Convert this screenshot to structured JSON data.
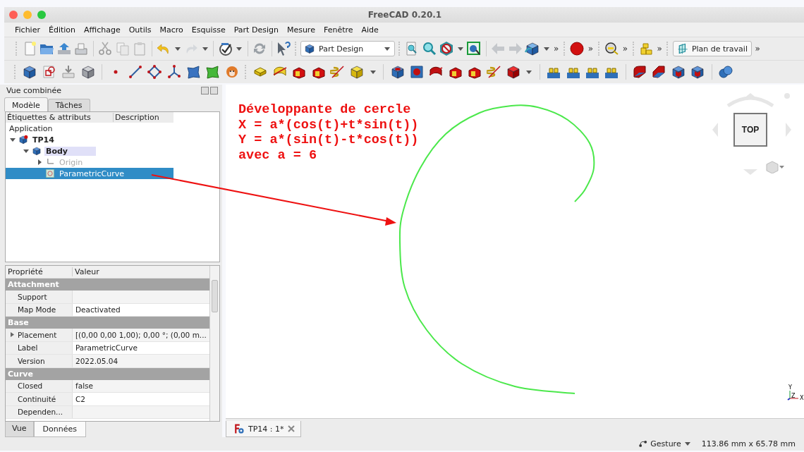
{
  "window": {
    "title": "FreeCAD 0.20.1"
  },
  "menu": [
    "Fichier",
    "Édition",
    "Affichage",
    "Outils",
    "Macro",
    "Esquisse",
    "Part Design",
    "Mesure",
    "Fenêtre",
    "Aide"
  ],
  "toolbar": {
    "workbench": "Part Design",
    "workplane_button": "Plan de travail",
    "chevrons": [
      "»",
      "»",
      "»",
      "»",
      "»"
    ]
  },
  "combo_view": {
    "title": "Vue combinée",
    "tabs": [
      {
        "label": "Modèle",
        "selected": true
      },
      {
        "label": "Tâches",
        "selected": false
      }
    ],
    "tree": {
      "columns": [
        "Étiquettes & attributs",
        "Description"
      ],
      "items": [
        {
          "label": "Application",
          "selected": false,
          "visible": true,
          "children": [
            {
              "label": "TP14",
              "kind": "document",
              "selected": false,
              "visible": true,
              "expanded": true,
              "children": [
                {
                  "label": "Body",
                  "kind": "body",
                  "selected": false,
                  "visible": true,
                  "active": true,
                  "expanded": true,
                  "children": [
                    {
                      "label": "Origin",
                      "kind": "origin",
                      "selected": false,
                      "visible": false,
                      "expanded": false
                    },
                    {
                      "label": "ParametricCurve",
                      "kind": "curve",
                      "selected": true,
                      "visible": true
                    }
                  ]
                }
              ]
            }
          ]
        }
      ]
    },
    "properties": {
      "columns": [
        "Propriété",
        "Valeur"
      ],
      "groups": [
        {
          "name": "Attachment",
          "rows": [
            {
              "name": "Support"
            },
            {
              "name": "Map Mode",
              "value": "Deactivated"
            }
          ]
        },
        {
          "name": "Base",
          "rows": [
            {
              "name": "Placement",
              "value": "[(0,00 0,00 1,00); 0,00 °; (0,00 m...",
              "expanded": false
            },
            {
              "name": "Label",
              "value": "ParametricCurve"
            },
            {
              "name": "Version",
              "value": "2022.05.04"
            }
          ]
        },
        {
          "name": "Curve",
          "rows": [
            {
              "name": "Closed",
              "value": "false"
            },
            {
              "name": "Continuité",
              "value": "C2"
            },
            {
              "name": "Dependen..."
            }
          ]
        }
      ]
    },
    "bottom_tabs": [
      {
        "label": "Vue",
        "selected": false
      },
      {
        "label": "Données",
        "selected": true
      }
    ]
  },
  "view": {
    "annotation": [
      "Développante de cercle",
      "X = a*(cos(t)+t*sin(t))",
      "Y = a*(sin(t)-t*cos(t))",
      "avec a = 6"
    ],
    "navcube_face": "TOP",
    "axis_labels": [
      "Y",
      "Z",
      "X"
    ]
  },
  "document_tabs": [
    {
      "label": "TP14 : 1*",
      "selected": true
    }
  ],
  "status_bar": {
    "navigation": "Gesture",
    "dimensions": "113.86 mm x 65.78 mm"
  }
}
